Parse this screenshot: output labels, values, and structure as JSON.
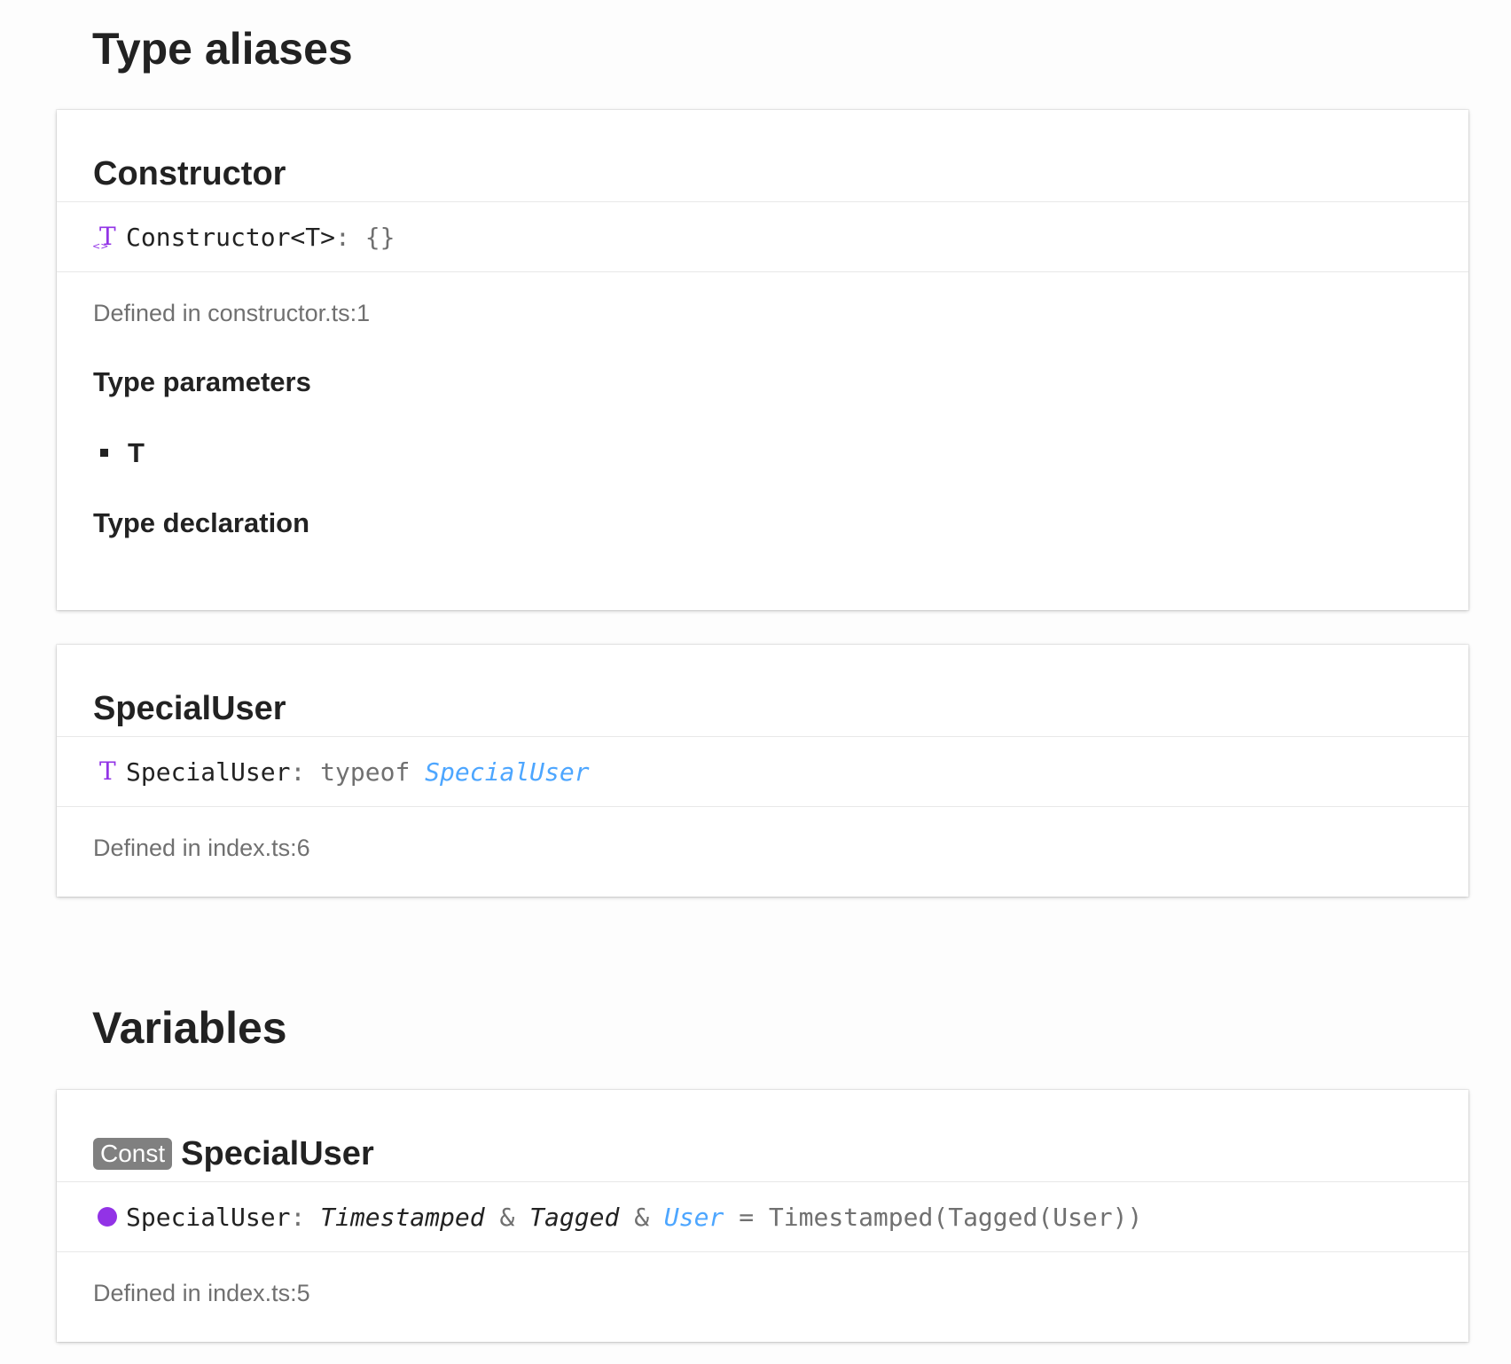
{
  "colors": {
    "accent_purple": "#9233e6",
    "link_blue": "#4da6ff",
    "muted_gray": "#707070",
    "badge_gray": "#808080"
  },
  "type_aliases": {
    "heading": "Type aliases",
    "constructor": {
      "title": "Constructor",
      "icon": "type-alias-generic-icon",
      "signature": {
        "name": "Constructor<T>",
        "colon": ":",
        "value": "{}"
      },
      "defined_in": "Defined in constructor.ts:1",
      "type_parameters_heading": "Type parameters",
      "type_parameters": [
        "T"
      ],
      "type_declaration_heading": "Type declaration"
    },
    "special_user": {
      "title": "SpecialUser",
      "icon": "type-alias-icon",
      "signature": {
        "name": "SpecialUser",
        "colon": ":",
        "keyword": "typeof",
        "ref": "SpecialUser"
      },
      "defined_in": "Defined in index.ts:6"
    }
  },
  "variables": {
    "heading": "Variables",
    "special_user": {
      "badge": "Const",
      "title": "SpecialUser",
      "icon": "variable-dot-icon",
      "signature": {
        "name": "SpecialUser",
        "colon": ":",
        "type_1": "Timestamped",
        "amp_1": "&",
        "type_2": "Tagged",
        "amp_2": "&",
        "type_3": "User",
        "equals": "=",
        "value": "Timestamped(Tagged(User))"
      },
      "defined_in": "Defined in index.ts:5"
    }
  }
}
